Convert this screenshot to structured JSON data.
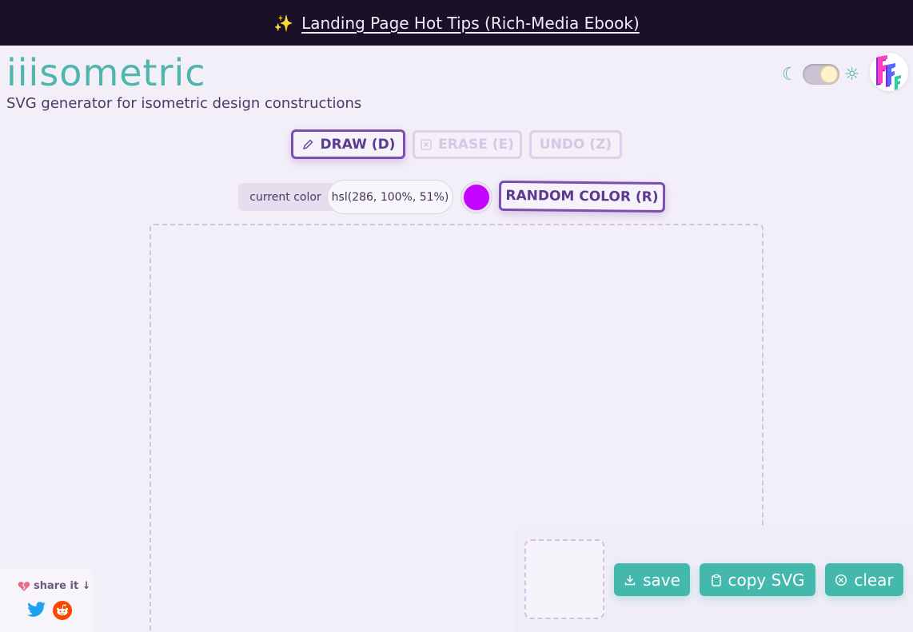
{
  "banner": {
    "emoji": "✨",
    "link_text": "Landing Page Hot Tips (Rich-Media Ebook)"
  },
  "brand": {
    "title": "iiisometric",
    "subtitle": "SVG generator for isometric design constructions"
  },
  "theme": {
    "moon": "☾",
    "sun": "☼"
  },
  "toolbar": {
    "draw": "DRAW (D)",
    "erase": "ERASE (E)",
    "undo": "UNDO (Z)"
  },
  "color": {
    "label": "current color",
    "value": "hsl(286, 100%, 51%)",
    "swatch_hex": "#c505ff",
    "random_label": "RANDOM COLOR (R)"
  },
  "actions": {
    "save": "save",
    "copy": "copy SVG",
    "clear": "clear"
  },
  "share": {
    "label": "share it ↓"
  },
  "colors": {
    "accent": "#44b8ad",
    "primary": "#7a4fb0",
    "banner_bg": "#1a1027"
  }
}
